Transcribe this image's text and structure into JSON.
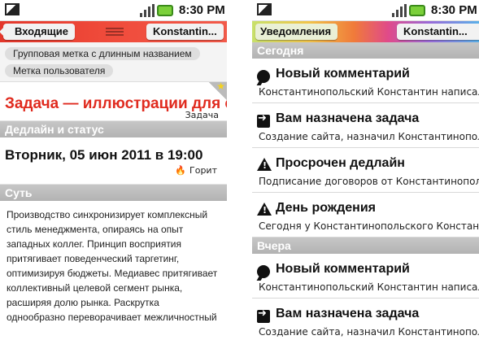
{
  "status": {
    "time": "8:30 PM"
  },
  "task": {
    "back_label": "Входящие",
    "user_label": "Konstantin...",
    "tags": [
      "Групповая метка с длинным названием",
      "Метка пользователя"
    ],
    "title": "Задача — иллюстрации для сайта",
    "type": "Задача",
    "deadline_header": "Дедлайн и статус",
    "deadline": "Вторник, 05 июн 2011 в 19:00",
    "status": "Горит",
    "essence_header": "Суть",
    "description": "Производство синхронизирует комплексный стиль менеджмента, опираясь на опыт западных коллег. Принцип восприятия притягивает поведенческий таргетинг, оптимизируя бюджеты. Медиавес притягивает коллективный целевой сегмент рынка, расширяя долю рынка. Раскрутка однообразно переворачивает межличностный нестандартный подход."
  },
  "notifications": {
    "back_label": "Уведомления",
    "user_label": "Konstantin...",
    "groups": [
      {
        "header": "Сегодня",
        "items": [
          {
            "icon": "comment-icon",
            "title": "Новый комментарий",
            "sub": "Константинопольский Константин написал в п"
          },
          {
            "icon": "arrow-icon",
            "title": "Вам назначена задача",
            "sub": "Создание сайта, назначил Константинопольски"
          },
          {
            "icon": "warning-icon",
            "title": "Просрочен дедлайн",
            "sub": "Подписание договоров  от Константинопольск"
          },
          {
            "icon": "warning-icon",
            "title": "День рождения",
            "sub": "Сегодня у Константинопольского Константина"
          }
        ]
      },
      {
        "header": "Вчера",
        "items": [
          {
            "icon": "comment-icon",
            "title": "Новый комментарий",
            "sub": "Константинопольский Константин написал в п"
          },
          {
            "icon": "arrow-icon",
            "title": "Вам назначена задача",
            "sub": "Создание сайта, назначил Константинопольски"
          }
        ]
      }
    ]
  }
}
